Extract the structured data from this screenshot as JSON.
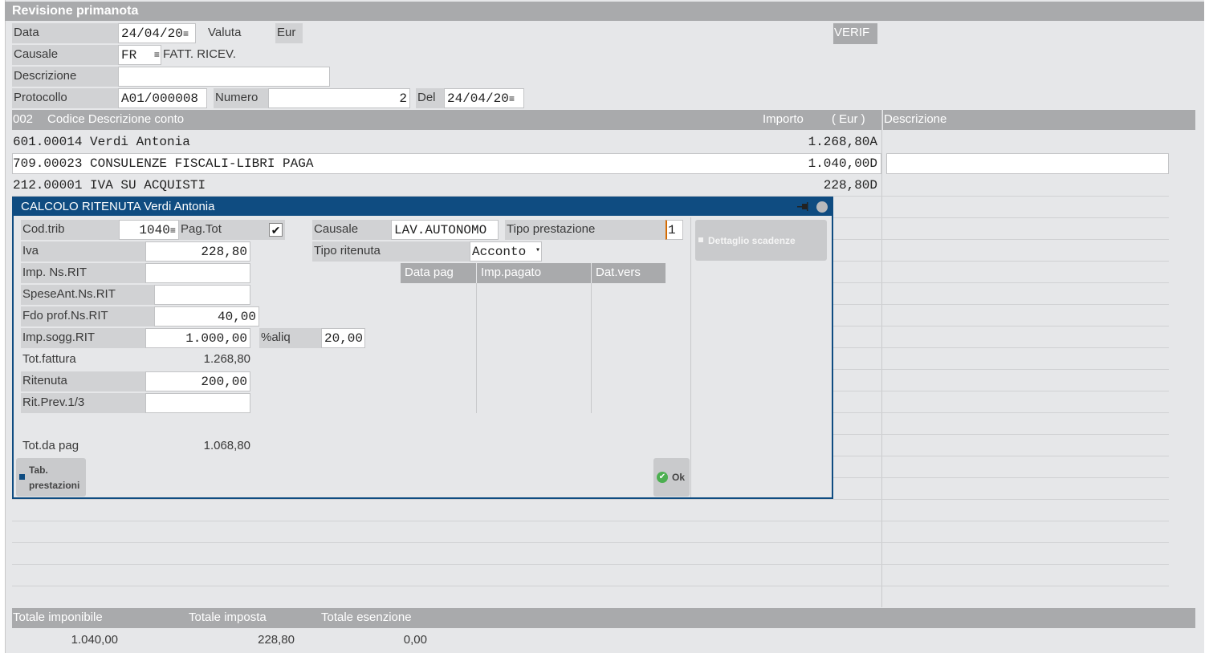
{
  "window": {
    "title": "Revisione primanota"
  },
  "header": {
    "data_label": "Data",
    "data_value": "24/04/20",
    "valuta_label": "Valuta",
    "valuta_value": "Eur",
    "verif_label": "VERIF",
    "causale_label": "Causale",
    "causale_code": "FR",
    "causale_desc": "FATT. RICEV.",
    "descrizione_label": "Descrizione",
    "descrizione_value": "",
    "protocollo_label": "Protocollo",
    "protocollo_value": "A01/000008",
    "numero_label": "Numero",
    "numero_value": "2",
    "del_label": "Del",
    "del_value": "24/04/20",
    "field_menu_glyph": "≡"
  },
  "grid": {
    "col_num": "002",
    "col_conto": "Codice Descrizione conto",
    "col_importo": "Importo",
    "col_valuta": "( Eur )",
    "col_descrizione": "Descrizione",
    "rows": [
      {
        "conto": "601.00014 Verdi Antonia",
        "importo": "1.268,80A",
        "descrizione": ""
      },
      {
        "conto": "709.00023 CONSULENZE FISCALI-LIBRI PAGA",
        "importo": "1.040,00D",
        "descrizione": ""
      },
      {
        "conto": "212.00001 IVA SU ACQUISTI",
        "importo": "228,80D",
        "descrizione": ""
      }
    ]
  },
  "dialog": {
    "title": "CALCOLO RITENUTA Verdi Antonia",
    "pin_icon": "pin-icon",
    "close_icon": "circle-icon",
    "cod_trib_label": "Cod.trib",
    "cod_trib_value": "1040",
    "pag_tot_label": "Pag.Tot",
    "pag_tot_check": "✔",
    "iva_label": "Iva",
    "iva_value": "228,80",
    "imp_ns_rit_label": "Imp. Ns.RIT",
    "imp_ns_rit_value": "",
    "spese_ant_label": "SpeseAnt.Ns.RIT",
    "spese_ant_value": "",
    "fdo_prof_label": "Fdo prof.Ns.RIT",
    "fdo_prof_value": "40,00",
    "imp_sogg_label": "Imp.sogg.RIT",
    "imp_sogg_value": "1.000,00",
    "aliq_label": "%aliq",
    "aliq_value": "20,00",
    "tot_fattura_label": "Tot.fattura",
    "tot_fattura_value": "1.268,80",
    "ritenuta_label": "Ritenuta",
    "ritenuta_value": "200,00",
    "rit_prev_label": "Rit.Prev.1/3",
    "rit_prev_value": "",
    "tot_da_pag_label": "Tot.da pag",
    "tot_da_pag_value": "1.068,80",
    "causale_label": "Causale",
    "causale_value": "LAV.AUTONOMO",
    "tipo_prestazione_label": "Tipo prestazione",
    "tipo_prestazione_value": "1",
    "tipo_ritenuta_label": "Tipo ritenuta",
    "tipo_ritenuta_value": "Acconto",
    "col_data_pag": "Data pag",
    "col_imp_pagato": "Imp.pagato",
    "col_dat_vers": "Dat.vers",
    "dettaglio_label": "Dettaglio scadenze",
    "tab_prestazioni_line1": "Tab.",
    "tab_prestazioni_line2": "prestazioni",
    "ok_label": "Ok"
  },
  "totals": {
    "imponibile_label": "Totale imponibile",
    "imposta_label": "Totale imposta",
    "esenzione_label": "Totale esenzione",
    "imponibile_value": "1.040,00",
    "imposta_value": "228,80",
    "esenzione_value": "0,00"
  },
  "colors": {
    "dialog_accent": "#0f4c81",
    "header_gray": "#a9aaac",
    "label_gray": "#d1d2d4",
    "window_bg": "#e6e7e9",
    "ok_green": "#4caf50"
  }
}
